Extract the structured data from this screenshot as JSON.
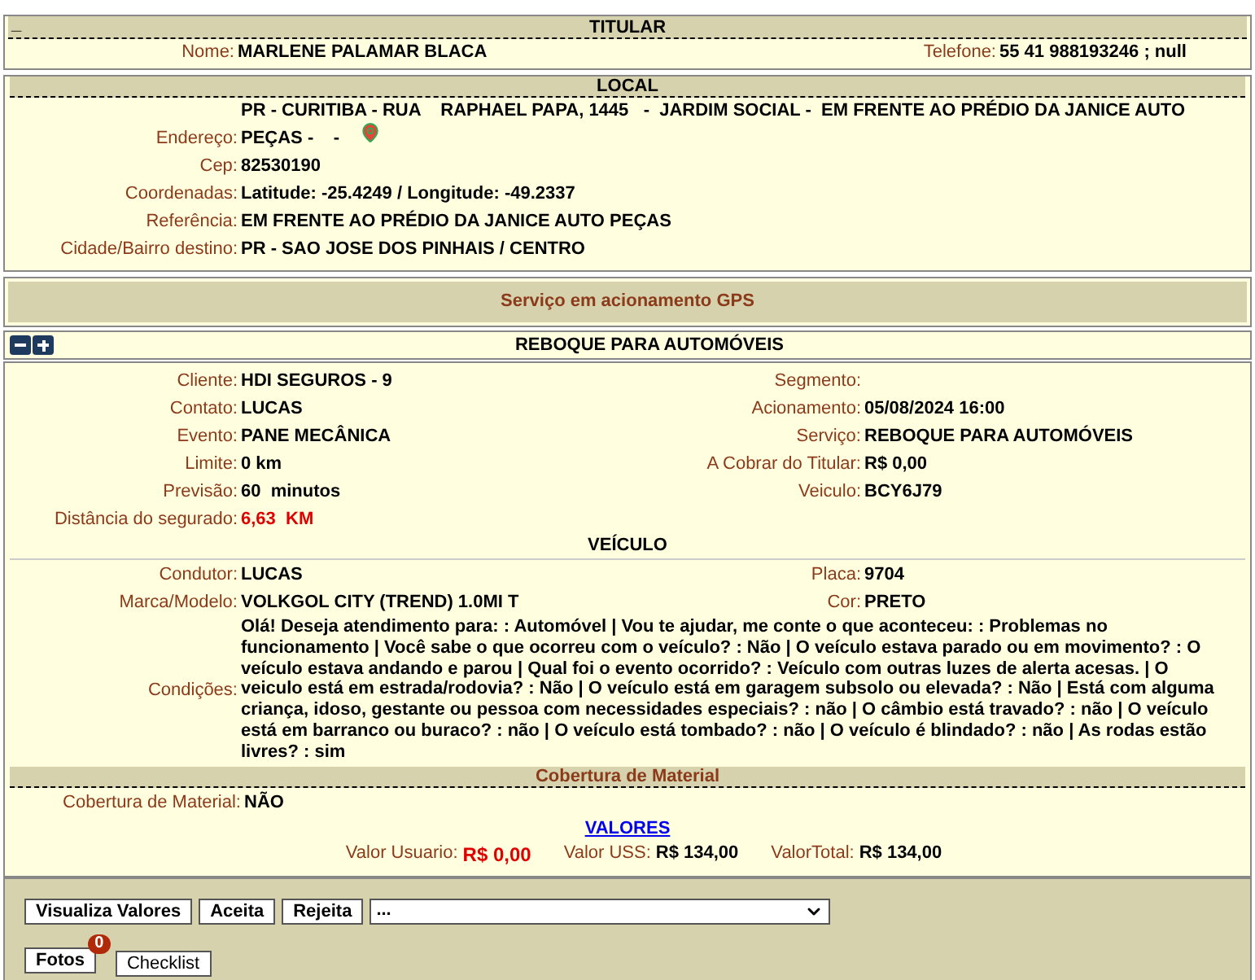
{
  "titular": {
    "collapse": "_",
    "title": "TITULAR",
    "fields": [
      {
        "label": "Nome:",
        "value": "MARLENE PALAMAR BLACA"
      },
      {
        "label": "Telefone:",
        "value": "55 41 988193246 ; null"
      }
    ]
  },
  "local": {
    "title": "LOCAL",
    "address": {
      "label": "Endereço:",
      "lines": [
        "PR - CURITIBA - RUA    RAPHAEL PAPA, 1445   -  JARDIM SOCIAL -  EM FRENTE AO PRÉDIO DA JANICE AUTO",
        "PEÇAS -    -"
      ]
    },
    "fields": [
      {
        "label": "Cep:",
        "value": "82530190"
      },
      {
        "label": "Coordenadas:",
        "value": "Latitude: -25.4249 / Longitude: -49.2337"
      },
      {
        "label": "Referência:",
        "value": "EM FRENTE AO PRÉDIO DA JANICE AUTO PEÇAS"
      },
      {
        "label": "Cidade/Bairro destino:",
        "value": "PR - SAO JOSE DOS PINHAIS / CENTRO"
      }
    ]
  },
  "status_banner": "Serviço em acionamento GPS",
  "service": {
    "title": "REBOQUE PARA AUTOMÓVEIS",
    "details": [
      {
        "label": "Cliente:",
        "value": "HDI SEGUROS - 9",
        "highlight": false
      },
      {
        "label": "Segmento:"
      },
      {
        "label": "Contato:",
        "value": "LUCAS",
        "highlight": false
      },
      {
        "label": "Acionamento:",
        "value": "05/08/2024 16:00",
        "highlight": false
      },
      {
        "label": "Evento:",
        "value": "PANE MECÂNICA",
        "highlight": false
      },
      {
        "label": "Serviço:",
        "value": "REBOQUE PARA AUTOMÓVEIS",
        "highlight": false
      },
      {
        "label": "Limite:",
        "value": "0 km",
        "highlight": false
      },
      {
        "label": "A Cobrar do Titular:",
        "value": "R$ 0,00",
        "highlight": false
      },
      {
        "label": "Previsão:",
        "value": "60  minutos",
        "highlight": false
      },
      {
        "label": "Veiculo:",
        "value": "BCY6J79",
        "highlight": false
      },
      {
        "label": "Distância do segurado:",
        "value": "6,63  KM",
        "highlight": true
      }
    ]
  },
  "vehicle": {
    "title": "VEÍCULO",
    "fields": [
      {
        "label": "Condutor:",
        "value": "LUCAS"
      },
      {
        "label": "Placa:",
        "value": "9704"
      },
      {
        "label": "Marca/Modelo:",
        "value": "VOLKGOL CITY (TREND) 1.0MI T"
      },
      {
        "label": "Cor:",
        "value": "PRETO"
      }
    ],
    "conditions": {
      "label": "Condições:",
      "value": "Olá! Deseja atendimento para: : Automóvel | Vou te ajudar, me conte o que aconteceu: : Problemas no funcionamento | Você sabe o que ocorreu com o veículo? : Não | O veículo estava parado ou em movimento? : O veículo estava andando e parou | Qual foi o evento ocorrido? : Veículo com outras luzes de alerta acesas. | O veiculo está em estrada/rodovia? : Não | O veículo está em garagem subsolo ou elevada? : Não | Está com alguma criança, idoso, gestante ou pessoa com necessidades especiais? : não | O câmbio está travado? : não | O veículo está em barranco ou buraco? : não | O veículo está tombado? : não | O veículo é blindado? : não | As rodas estão livres? : sim"
    }
  },
  "coverage": {
    "title": "Cobertura de Material",
    "label": "Cobertura de Material:",
    "value": "NÃO"
  },
  "values": {
    "link": "VALORES",
    "items": [
      {
        "label": "Valor Usuario:",
        "value": "R$ 0,00",
        "highlight": true
      },
      {
        "label": "Valor USS:",
        "value": "R$ 134,00",
        "highlight": false
      },
      {
        "label": "ValorTotal:",
        "value": "R$ 134,00",
        "highlight": false
      }
    ]
  },
  "actions": {
    "buttons": [
      "Visualiza Valores",
      "Aceita",
      "Rejeita"
    ],
    "select": {
      "value": "..."
    },
    "photos": {
      "label": "Fotos",
      "count": "0"
    },
    "checklist": "Checklist"
  }
}
